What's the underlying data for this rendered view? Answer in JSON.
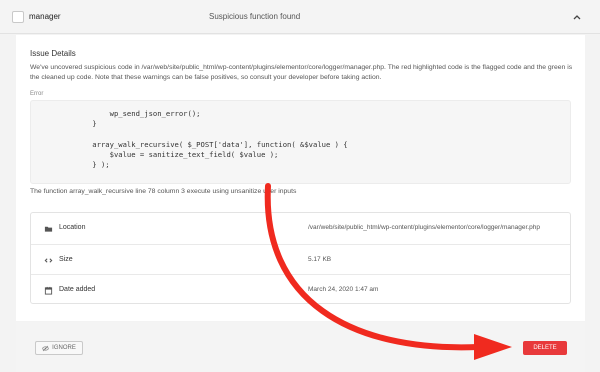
{
  "issue": {
    "filename": "manager",
    "status_label": "Suspicious function found"
  },
  "details": {
    "title": "Issue Details",
    "description": "We've uncovered suspicious code in /var/web/site/public_html/wp-content/plugins/elementor/core/logger/manager.php. The red highlighted code is the flagged code and the green is the cleaned up code. Note that these warnings can be false positives, so consult your developer before taking action.",
    "error_label": "Error",
    "code": "        wp_send_json_error();\n    }\n\n    array_walk_recursive( $_POST['data'], function( &$value ) {\n        $value = sanitize_text_field( $value );\n    } );",
    "function_note": "The function array_walk_recursive line 78 column 3 execute using unsanitize user inputs"
  },
  "meta": {
    "location_label": "Location",
    "location_value": "/var/web/site/public_html/wp-content/plugins/elementor/core/logger/manager.php",
    "size_label": "Size",
    "size_value": "5.17 KB",
    "date_label": "Date added",
    "date_value": "March 24, 2020 1:47 am"
  },
  "actions": {
    "ignore_label": "IGNORE",
    "delete_label": "DELETE"
  },
  "colors": {
    "delete": "#e8393b",
    "annotation_arrow": "#f02a1f"
  }
}
